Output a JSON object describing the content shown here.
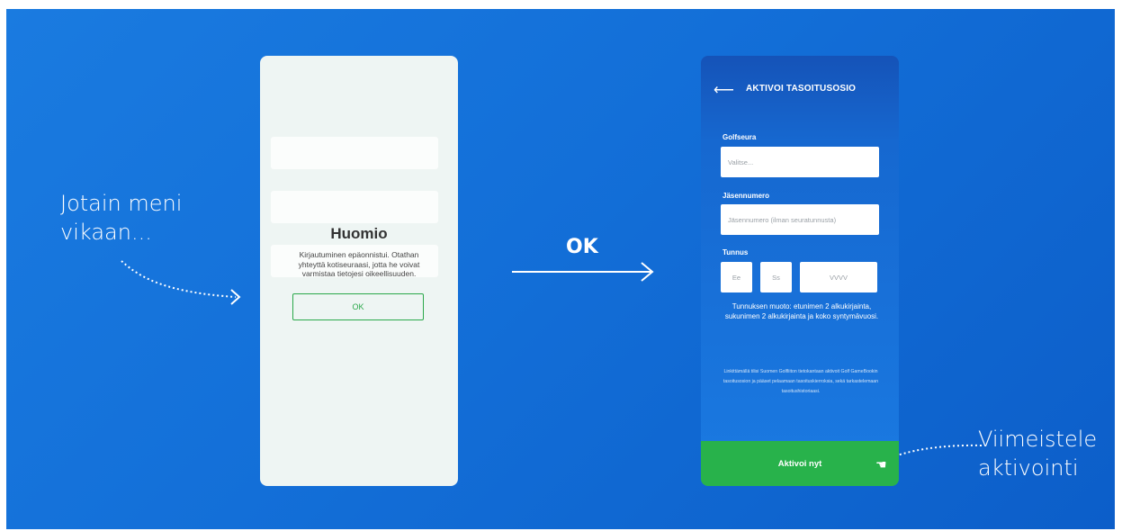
{
  "left_caption": [
    "Jotain meni",
    "vikaan..."
  ],
  "right_caption": [
    "Viimeistele",
    "aktivointi"
  ],
  "middle_label": "OK",
  "left_phone": {
    "modal": {
      "title": "Huomio",
      "message": "Kirjautuminen epäonnistui. Otathan yhteyttä kotiseuraasi, jotta he voivat varmistaa tietojesi oikeellisuuden.",
      "ok_button": "OK"
    }
  },
  "right_phone": {
    "back_icon": "arrow-left-icon",
    "title": "AKTIVOI TASOITUSOSIO",
    "golfseura": {
      "label": "Golfseura",
      "placeholder": "Valitse..."
    },
    "jasennumero": {
      "label": "Jäsennumero",
      "placeholder": "Jäsennumero (ilman seuratunnusta)"
    },
    "tunnus": {
      "label": "Tunnus",
      "fields": [
        "Ee",
        "Ss",
        "VVVV"
      ]
    },
    "hint": "Tunnuksen muoto: etunimen 2 alkukirjainta, sukunimen 2 alkukirjainta ja koko syntymävuosi.",
    "legal": "Linkittämällä tilisi Suomen Golfliiton tietokantaan aktivoit Golf GameBookin tasoitusosion ja pääset pelaamaan tasoituskierroksia, sekä tarkastelemaan tasoitushistoriaasi.",
    "activate_button": "Aktivoi nyt"
  },
  "colors": {
    "background": "#136fd8",
    "green": "#28b24b"
  }
}
